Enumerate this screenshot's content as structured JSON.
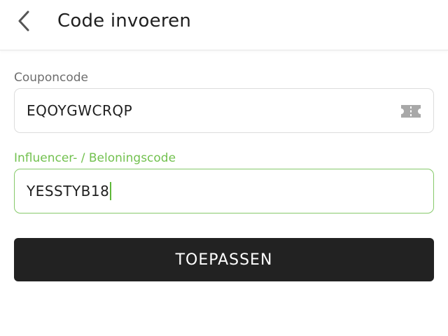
{
  "header": {
    "back_icon": "chevron-left-icon",
    "title": "Code invoeren"
  },
  "coupon": {
    "label": "Couponcode",
    "value": "EQOYGWCRQP",
    "icon": "ticket-icon"
  },
  "influencer": {
    "label": "Influencer- / Beloningscode",
    "value": "YESSTYB18",
    "focused": true
  },
  "actions": {
    "apply_label": "TOEPASSEN"
  },
  "colors": {
    "accent_green": "#72c14f",
    "button_bg": "#222222",
    "text_primary": "#1f1f1f",
    "label_gray": "#6e6e6e"
  }
}
